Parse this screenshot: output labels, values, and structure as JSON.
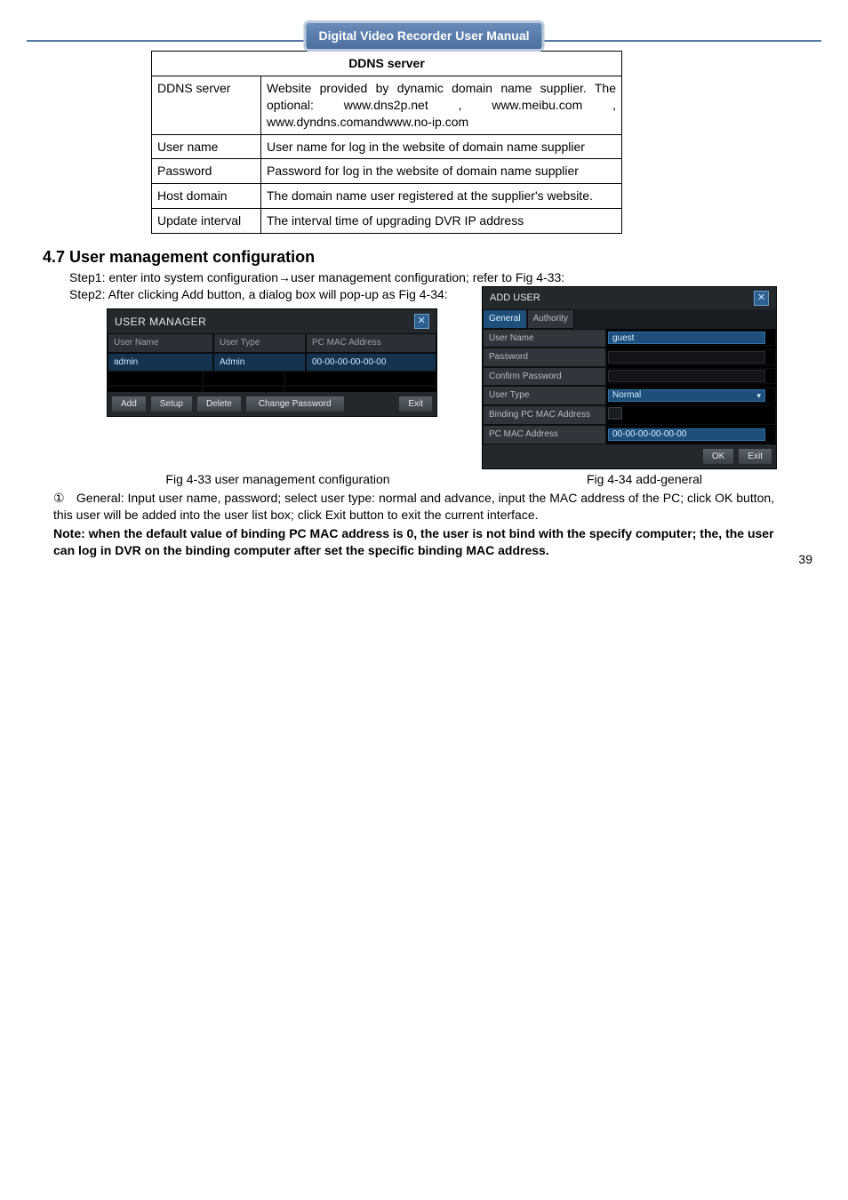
{
  "header": {
    "title": "Digital Video Recorder User Manual"
  },
  "ddns_table": {
    "title": "DDNS server",
    "rows": {
      "r1k": "DDNS server",
      "r1v": "Website provided by dynamic domain name supplier. The optional: www.dns2p.net , www.meibu.com , www.dyndns.comandwww.no-ip.com",
      "r2k": "User name",
      "r2v": "User name for log in the website of domain name supplier",
      "r3k": "Password",
      "r3v": "Password for log in the website of domain name supplier",
      "r4k": "Host domain",
      "r4v": "The domain name user registered at the supplier's website.",
      "r5k": "Update interval",
      "r5v": "The interval time of upgrading DVR IP address"
    }
  },
  "section": {
    "num_title": "4.7  User management configuration",
    "step1": "Step1: enter into system configuration→user management configuration; refer to Fig 4-33:",
    "step2": "Step2: After clicking Add button, a dialog box will pop-up as Fig 4-34:"
  },
  "user_manager": {
    "title": "USER  MANAGER",
    "col1": "User  Name",
    "col2": "User  Type",
    "col3": "PC  MAC  Address",
    "row_user": "admin",
    "row_type": "Admin",
    "row_mac": "00-00-00-00-00-00",
    "btn_add": "Add",
    "btn_setup": "Setup",
    "btn_delete": "Delete",
    "btn_chpwd": "Change  Password",
    "btn_exit": "Exit"
  },
  "add_user": {
    "title": "ADD  USER",
    "tab_general": "General",
    "tab_authority": "Authority",
    "lbl_name": "User  Name",
    "val_name": "guest",
    "lbl_pwd": "Password",
    "lbl_cpwd": "Confirm  Password",
    "lbl_type": "User  Type",
    "val_type": "Normal",
    "lbl_bind": "Binding  PC  MAC  Address",
    "lbl_mac": "PC  MAC  Address",
    "val_mac": "00-00-00-00-00-00",
    "btn_ok": "OK",
    "btn_exit": "Exit"
  },
  "captions": {
    "c1": "Fig 4-33 user management configuration",
    "c2": "Fig 4-34 add-general"
  },
  "para": {
    "circ": "①",
    "line1": "General: Input user name, password; select user type: normal and advance, input the MAC address of the PC; click OK button, this user will be added into the user list box; click Exit button to exit the current interface.",
    "note": "Note: when the default value of binding PC MAC address is 0, the user is not bind with the specify computer; the, the user can log in DVR on the binding computer after set the specific binding MAC address."
  },
  "page_number": "39"
}
